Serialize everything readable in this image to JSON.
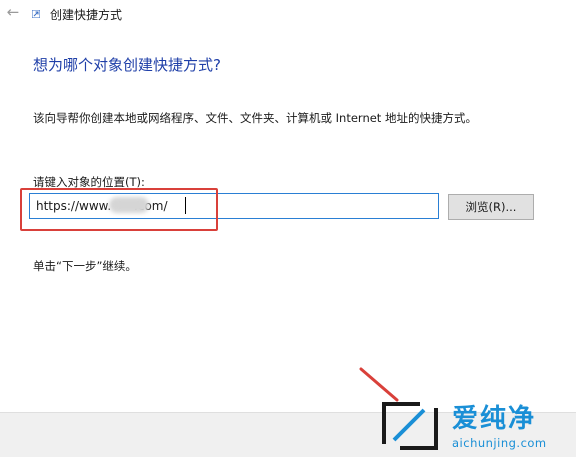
{
  "titlebar": {
    "back_icon": "back-arrow-icon",
    "title": "创建快捷方式"
  },
  "main": {
    "heading": "想为哪个对象创建快捷方式?",
    "description": "该向导帮你创建本地或网络程序、文件、文件夹、计算机或 Internet 地址的快捷方式。",
    "location_label": "请键入对象的位置(T):",
    "location_value": "https://www.      .com/",
    "browse_label": "浏览(R)...",
    "hint": "单击“下一步”继续。"
  },
  "annotations": {
    "highlight_color": "#d9403a",
    "arrow_color": "#d9403a"
  },
  "watermark": {
    "brand": "爱纯净",
    "url": "aichunjing.com",
    "color": "#1a8fd6"
  },
  "colors": {
    "heading": "#1f3fa8",
    "input_border": "#2a7fd4",
    "footer_bg": "#f0f0f0"
  }
}
